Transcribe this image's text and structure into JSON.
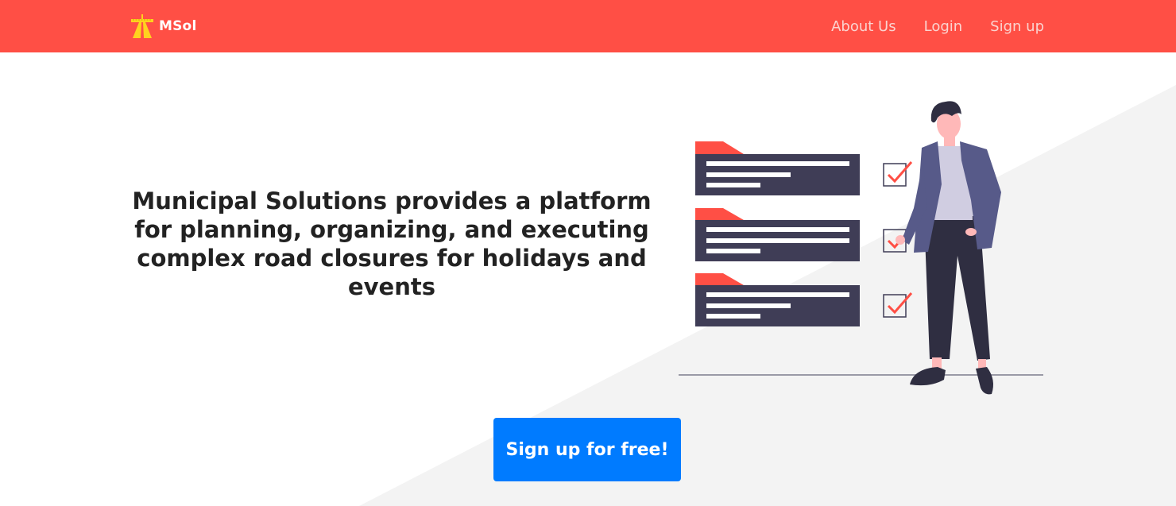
{
  "navbar": {
    "brand": {
      "logo_icon": "road-icon",
      "name": "MSol"
    },
    "links": [
      {
        "label": "About Us"
      },
      {
        "label": "Login"
      },
      {
        "label": "Sign up"
      }
    ],
    "background_color": "#ff4f45"
  },
  "hero": {
    "headline": "Municipal Solutions provides a platform for planning, organizing, and executing complex road closures for holidays and events",
    "illustration": {
      "description_icon": "checklist-person-icon",
      "checklist_items": 3,
      "checked_items": 3
    },
    "cta_label": "Sign up for free!",
    "cta_color": "#007bff"
  },
  "colors": {
    "accent_red": "#ff4f45",
    "panel_dark": "#3f3d56",
    "diagonal_gray": "#f2f2f2"
  }
}
